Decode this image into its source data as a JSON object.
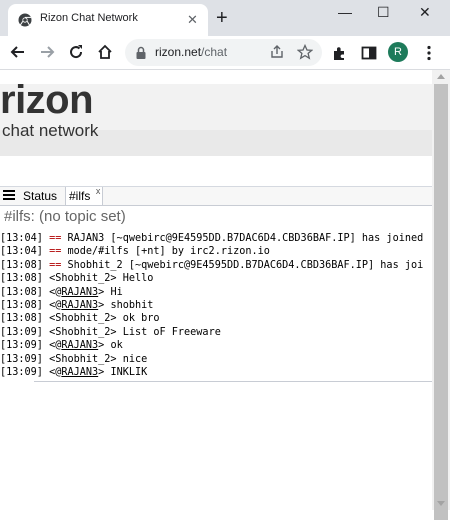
{
  "browser": {
    "tab_title": "Rizon Chat Network",
    "tab_close": "✕",
    "new_tab": "+",
    "window_controls": [
      "—",
      "☐",
      "✕"
    ],
    "url_domain": "rizon.net",
    "url_path": "/chat",
    "profile_initial": "R"
  },
  "page": {
    "logo": "rizon",
    "subtitle": "chat network"
  },
  "chat": {
    "tabs": [
      {
        "label": "Status"
      },
      {
        "label": "#ilfs",
        "close": "x"
      }
    ],
    "topic": "#ilfs: (no topic set)",
    "messages": [
      {
        "time": "[13:04]",
        "marker": "==",
        "text": " RAJAN3 [~qwebirc@9E4595DD.B7DAC6D4.CBD36BAF.IP] has joined"
      },
      {
        "time": "[13:04]",
        "marker": "==",
        "text": " mode/#ilfs [+nt] by irc2.rizon.io"
      },
      {
        "time": "[13:08]",
        "marker": "==",
        "text": " Shobhit_2 [~qwebirc@9E4595DD.B7DAC6D4.CBD36BAF.IP] has joi"
      },
      {
        "time": "[13:08]",
        "nick": "Shobhit_2",
        "op": false,
        "text": "Hello"
      },
      {
        "time": "[13:08]",
        "nick": "RAJAN3",
        "op": true,
        "text": "Hi"
      },
      {
        "time": "[13:08]",
        "nick": "RAJAN3",
        "op": true,
        "text": "shobhit"
      },
      {
        "time": "[13:08]",
        "nick": "Shobhit_2",
        "op": false,
        "text": "ok bro"
      },
      {
        "time": "[13:09]",
        "nick": "Shobhit_2",
        "op": false,
        "text": "List oF Freeware"
      },
      {
        "time": "[13:09]",
        "nick": "RAJAN3",
        "op": true,
        "text": "ok"
      },
      {
        "time": "[13:09]",
        "nick": "Shobhit_2",
        "op": false,
        "text": "nice"
      },
      {
        "time": "[13:09]",
        "nick": "RAJAN3",
        "op": true,
        "text": "INKLIK"
      }
    ]
  },
  "colors": {
    "event": "#b00000",
    "chrome_bg": "#dee1e6",
    "avatar": "#1e7b5b"
  }
}
